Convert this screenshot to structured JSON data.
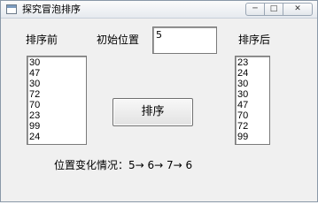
{
  "window": {
    "title": "探究冒泡排序",
    "controls": {
      "minimize": "─",
      "maximize": "□",
      "close": "✕"
    }
  },
  "labels": {
    "before": "排序前",
    "initial_position": "初始位置",
    "after": "排序后"
  },
  "initial_position_value": "5",
  "list_before": [
    "30",
    "47",
    "30",
    "72",
    "70",
    "23",
    "99",
    "24"
  ],
  "list_after": [
    "23",
    "24",
    "30",
    "30",
    "47",
    "70",
    "72",
    "99"
  ],
  "sort_button_label": "排序",
  "position_change": {
    "label": "位置变化情况：",
    "value": "5→ 6→ 7→ 6"
  }
}
